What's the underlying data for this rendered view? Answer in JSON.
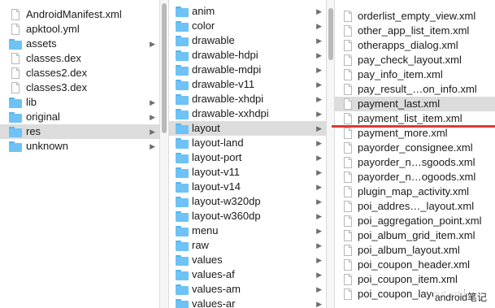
{
  "columns": [
    {
      "items": [
        {
          "label": "AndroidManifest.xml",
          "kind": "file",
          "icon": "file-icon"
        },
        {
          "label": "apktool.yml",
          "kind": "file",
          "icon": "file-icon"
        },
        {
          "label": "assets",
          "kind": "folder",
          "icon": "folder-icon",
          "chevron": "▶"
        },
        {
          "label": "classes.dex",
          "kind": "file",
          "icon": "file-icon"
        },
        {
          "label": "classes2.dex",
          "kind": "file",
          "icon": "file-icon"
        },
        {
          "label": "classes3.dex",
          "kind": "file",
          "icon": "file-icon"
        },
        {
          "label": "lib",
          "kind": "folder",
          "icon": "folder-icon",
          "chevron": "▶"
        },
        {
          "label": "original",
          "kind": "folder",
          "icon": "folder-icon",
          "chevron": "▶"
        },
        {
          "label": "res",
          "kind": "folder",
          "icon": "folder-icon",
          "chevron": "▶",
          "selected": true
        },
        {
          "label": "unknown",
          "kind": "folder",
          "icon": "folder-icon",
          "chevron": "▶"
        }
      ]
    },
    {
      "items": [
        {
          "label": "anim",
          "kind": "folder",
          "icon": "folder-icon",
          "chevron": "▶"
        },
        {
          "label": "color",
          "kind": "folder",
          "icon": "folder-icon",
          "chevron": "▶"
        },
        {
          "label": "drawable",
          "kind": "folder",
          "icon": "folder-icon",
          "chevron": "▶"
        },
        {
          "label": "drawable-hdpi",
          "kind": "folder",
          "icon": "folder-icon",
          "chevron": "▶"
        },
        {
          "label": "drawable-mdpi",
          "kind": "folder",
          "icon": "folder-icon",
          "chevron": "▶"
        },
        {
          "label": "drawable-v11",
          "kind": "folder",
          "icon": "folder-icon",
          "chevron": "▶"
        },
        {
          "label": "drawable-xhdpi",
          "kind": "folder",
          "icon": "folder-icon",
          "chevron": "▶"
        },
        {
          "label": "drawable-xxhdpi",
          "kind": "folder",
          "icon": "folder-icon",
          "chevron": "▶"
        },
        {
          "label": "layout",
          "kind": "folder",
          "icon": "folder-icon",
          "chevron": "▶",
          "selected": true
        },
        {
          "label": "layout-land",
          "kind": "folder",
          "icon": "folder-icon",
          "chevron": "▶"
        },
        {
          "label": "layout-port",
          "kind": "folder",
          "icon": "folder-icon",
          "chevron": "▶"
        },
        {
          "label": "layout-v11",
          "kind": "folder",
          "icon": "folder-icon",
          "chevron": "▶"
        },
        {
          "label": "layout-v14",
          "kind": "folder",
          "icon": "folder-icon",
          "chevron": "▶"
        },
        {
          "label": "layout-w320dp",
          "kind": "folder",
          "icon": "folder-icon",
          "chevron": "▶"
        },
        {
          "label": "layout-w360dp",
          "kind": "folder",
          "icon": "folder-icon",
          "chevron": "▶"
        },
        {
          "label": "menu",
          "kind": "folder",
          "icon": "folder-icon",
          "chevron": "▶"
        },
        {
          "label": "raw",
          "kind": "folder",
          "icon": "folder-icon",
          "chevron": "▶"
        },
        {
          "label": "values",
          "kind": "folder",
          "icon": "folder-icon",
          "chevron": "▶"
        },
        {
          "label": "values-af",
          "kind": "folder",
          "icon": "folder-icon",
          "chevron": "▶"
        },
        {
          "label": "values-am",
          "kind": "folder",
          "icon": "folder-icon",
          "chevron": "▶"
        },
        {
          "label": "values-ar",
          "kind": "folder",
          "icon": "folder-icon",
          "chevron": "▶"
        }
      ]
    },
    {
      "items": [
        {
          "label": "orderlist_empty_view.xml",
          "kind": "file",
          "icon": "file-icon"
        },
        {
          "label": "other_app_list_item.xml",
          "kind": "file",
          "icon": "file-icon"
        },
        {
          "label": "otherapps_dialog.xml",
          "kind": "file",
          "icon": "file-icon"
        },
        {
          "label": "pay_check_layout.xml",
          "kind": "file",
          "icon": "file-icon"
        },
        {
          "label": "pay_info_item.xml",
          "kind": "file",
          "icon": "file-icon"
        },
        {
          "label": "pay_result_…on_info.xml",
          "kind": "file",
          "icon": "file-icon"
        },
        {
          "label": "payment_last.xml",
          "kind": "file",
          "icon": "file-icon",
          "selected": true
        },
        {
          "label": "payment_list_item.xml",
          "kind": "file",
          "icon": "file-icon"
        },
        {
          "label": "payment_more.xml",
          "kind": "file",
          "icon": "file-icon"
        },
        {
          "label": "payorder_consignee.xml",
          "kind": "file",
          "icon": "file-icon"
        },
        {
          "label": "payorder_n…sgoods.xml",
          "kind": "file",
          "icon": "file-icon"
        },
        {
          "label": "payorder_n…ogoods.xml",
          "kind": "file",
          "icon": "file-icon"
        },
        {
          "label": "plugin_map_activity.xml",
          "kind": "file",
          "icon": "file-icon"
        },
        {
          "label": "poi_addres…_layout.xml",
          "kind": "file",
          "icon": "file-icon"
        },
        {
          "label": "poi_aggregation_point.xml",
          "kind": "file",
          "icon": "file-icon"
        },
        {
          "label": "poi_album_grid_item.xml",
          "kind": "file",
          "icon": "file-icon"
        },
        {
          "label": "poi_album_layout.xml",
          "kind": "file",
          "icon": "file-icon"
        },
        {
          "label": "poi_coupon_header.xml",
          "kind": "file",
          "icon": "file-icon"
        },
        {
          "label": "poi_coupon_item.xml",
          "kind": "file",
          "icon": "file-icon"
        },
        {
          "label": "poi_coupon_layout.xml",
          "kind": "file",
          "icon": "file-icon"
        }
      ]
    }
  ],
  "watermark": "android笔记",
  "colors": {
    "selection": "#dcdcdc",
    "folder": "#6ec2f5",
    "annotation_line": "#e03a33"
  }
}
